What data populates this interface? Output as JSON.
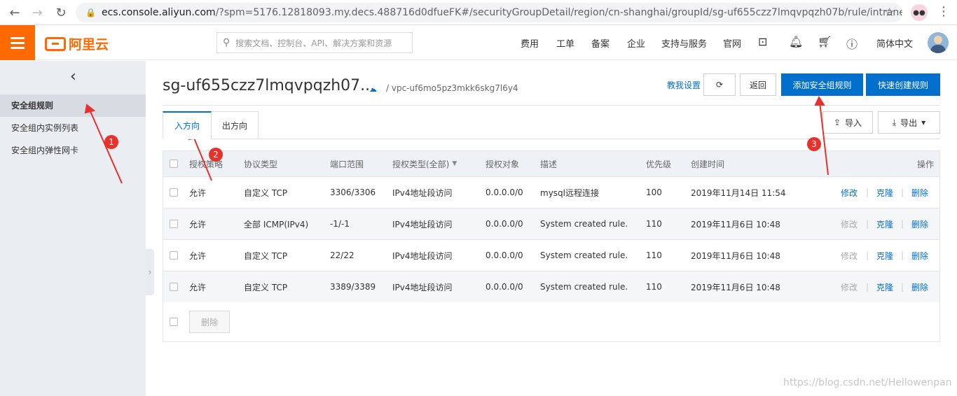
{
  "browser": {
    "url_domain": "ecs.console.aliyun.com",
    "url_path": "/?spm=5176.12818093.my.decs.488716d0dfueFK#/securityGroupDetail/region/cn-shanghai/groupId/sg-uf655czz7lmqvpqzh07b/rule/intrane..."
  },
  "topbar": {
    "logo_text": "阿里云",
    "search_placeholder": "搜索文档、控制台、API、解决方案和资源",
    "menu": [
      "费用",
      "工单",
      "备案",
      "企业",
      "支持与服务",
      "官网"
    ],
    "language": "简体中文"
  },
  "sidebar": {
    "items": [
      "安全组规则",
      "安全组内实例列表",
      "安全组内弹性网卡"
    ]
  },
  "header": {
    "title": "sg-uf655czz7lmqvpqzh07...",
    "vpc": "/ vpc-uf6mo5pz3mkk6skg7l6y4",
    "help_link": "教我设置",
    "back_label": "返回",
    "add_rule_label": "添加安全组规则",
    "quick_create_label": "快速创建规则"
  },
  "tabs": [
    "入方向",
    "出方向"
  ],
  "toolbar": {
    "import_label": "导入",
    "export_label": "导出"
  },
  "table": {
    "columns": [
      "授权策略",
      "协议类型",
      "端口范围",
      "授权类型(全部)",
      "授权对象",
      "描述",
      "优先级",
      "创建时间",
      "操作"
    ],
    "rows": [
      {
        "policy": "允许",
        "protocol": "自定义 TCP",
        "ports": "3306/3306",
        "auth_type": "IPv4地址段访问",
        "target": "0.0.0.0/0",
        "desc": "mysql远程连接",
        "priority": "100",
        "created": "2019年11月14日 11:54",
        "edit": "修改",
        "edit_enabled": true,
        "clone": "克隆",
        "delete": "删除"
      },
      {
        "policy": "允许",
        "protocol": "全部 ICMP(IPv4)",
        "ports": "-1/-1",
        "auth_type": "IPv4地址段访问",
        "target": "0.0.0.0/0",
        "desc": "System created rule.",
        "priority": "110",
        "created": "2019年11月6日 10:48",
        "edit": "修改",
        "edit_enabled": false,
        "clone": "克隆",
        "delete": "删除"
      },
      {
        "policy": "允许",
        "protocol": "自定义 TCP",
        "ports": "22/22",
        "auth_type": "IPv4地址段访问",
        "target": "0.0.0.0/0",
        "desc": "System created rule.",
        "priority": "110",
        "created": "2019年11月6日 10:48",
        "edit": "修改",
        "edit_enabled": false,
        "clone": "克隆",
        "delete": "删除"
      },
      {
        "policy": "允许",
        "protocol": "自定义 TCP",
        "ports": "3389/3389",
        "auth_type": "IPv4地址段访问",
        "target": "0.0.0.0/0",
        "desc": "System created rule.",
        "priority": "110",
        "created": "2019年11月6日 10:48",
        "edit": "修改",
        "edit_enabled": false,
        "clone": "克隆",
        "delete": "删除"
      }
    ],
    "bulk_delete_label": "删除"
  },
  "annotations": [
    "1",
    "2",
    "3"
  ],
  "watermark": "https://blog.csdn.net/Hellowenpan",
  "colors": {
    "brand": "#ff6a00",
    "primary": "#0070cc",
    "annotation": "#e8312a"
  }
}
